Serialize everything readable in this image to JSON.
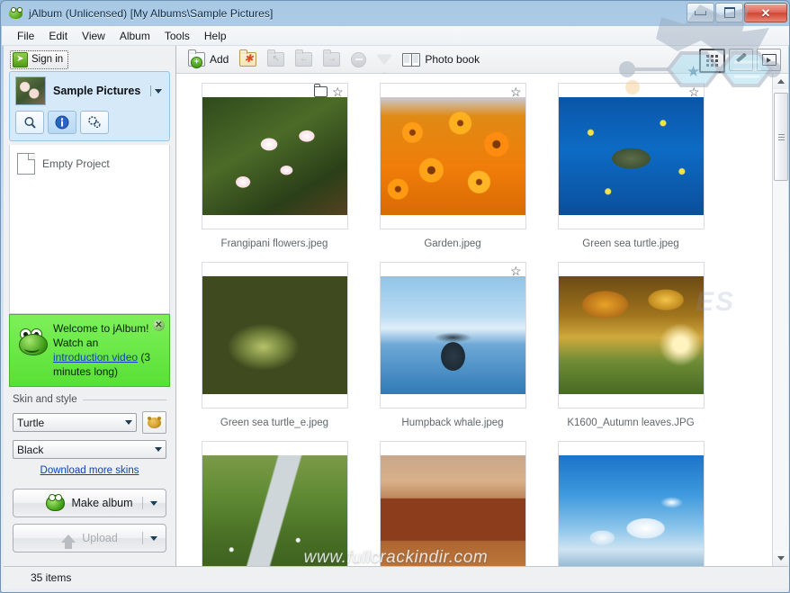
{
  "window": {
    "title": "jAlbum (Unlicensed) [My Albums\\Sample Pictures]",
    "app_icon": "frog-icon",
    "minimize_label": "–",
    "maximize_label": "",
    "close_label": "✕"
  },
  "menubar": {
    "items": [
      {
        "label": "File"
      },
      {
        "label": "Edit"
      },
      {
        "label": "View"
      },
      {
        "label": "Album"
      },
      {
        "label": "Tools"
      },
      {
        "label": "Help"
      }
    ]
  },
  "sidebar": {
    "signin": {
      "label": "Sign in",
      "icon": "arrow-right-icon"
    },
    "album": {
      "name": "Sample Pictures",
      "dropdown_icon": "chevron-down-icon",
      "tools": [
        {
          "name": "search-button",
          "icon": "magnifier-icon"
        },
        {
          "name": "info-button",
          "icon": "info-icon"
        },
        {
          "name": "settings-button",
          "icon": "gears-icon"
        }
      ]
    },
    "projects": [
      {
        "label": "Empty Project",
        "icon": "page-icon"
      }
    ],
    "welcome": {
      "line1": "Welcome to jAlbum!",
      "line2": "Watch an",
      "link": "introduction video",
      "line3": " (3 minutes long)",
      "close_label": "✕",
      "icon": "frog-icon"
    },
    "skin_section": {
      "legend": "Skin and style",
      "skin_value": "Turtle",
      "style_value": "Black",
      "skin_options": [
        "Turtle"
      ],
      "style_options": [
        "Black"
      ],
      "preview_icon": "turtle-icon",
      "download_link": "Download more skins"
    },
    "actions": [
      {
        "label": "Make album",
        "icon": "frog-icon",
        "disabled": false
      },
      {
        "label": "Upload",
        "icon": "upload-arrow-icon",
        "disabled": true
      }
    ]
  },
  "toolbar": {
    "items": [
      {
        "label": "Add",
        "icon": "folder-add-icon",
        "disabled": false
      },
      {
        "label": "",
        "icon": "folder-new-icon",
        "disabled": false
      },
      {
        "label": "",
        "icon": "folder-up-icon",
        "disabled": true
      },
      {
        "label": "",
        "icon": "folder-back-icon",
        "disabled": true
      },
      {
        "label": "",
        "icon": "folder-forward-icon",
        "disabled": true
      },
      {
        "label": "",
        "icon": "remove-icon",
        "disabled": true
      },
      {
        "label": "",
        "icon": "filter-funnel-icon",
        "disabled": true
      },
      {
        "label": "Photo book",
        "icon": "book-icon",
        "disabled": false
      }
    ],
    "view_modes": [
      {
        "name": "grid-view-button",
        "icon": "grid-icon",
        "selected": true
      },
      {
        "name": "edit-view-button",
        "icon": "pen-icon",
        "selected": false
      },
      {
        "name": "slideshow-view-button",
        "icon": "play-icon",
        "selected": false
      }
    ]
  },
  "grid": {
    "items": [
      {
        "label": "Frangipani flowers.jpeg",
        "art": "img-frangipani",
        "has_folder_icon": true,
        "has_star_icon": true
      },
      {
        "label": "Garden.jpeg",
        "art": "img-garden",
        "has_folder_icon": false,
        "has_star_icon": true
      },
      {
        "label": "Green sea turtle.jpeg",
        "art": "img-turtle-blue",
        "has_folder_icon": false,
        "has_star_icon": true
      },
      {
        "label": "Green sea turtle_e.jpeg",
        "art": "img-turtle-close",
        "has_folder_icon": false,
        "has_star_icon": false
      },
      {
        "label": "Humpback whale.jpeg",
        "art": "img-whale",
        "has_folder_icon": false,
        "has_star_icon": true
      },
      {
        "label": "K1600_Autumn leaves.JPG",
        "art": "img-autumn",
        "has_folder_icon": false,
        "has_star_icon": false
      },
      {
        "label": "",
        "art": "img-creek",
        "has_folder_icon": false,
        "has_star_icon": false
      },
      {
        "label": "",
        "art": "img-monument",
        "has_folder_icon": false,
        "has_star_icon": false
      },
      {
        "label": "",
        "art": "img-clouds",
        "has_folder_icon": false,
        "has_star_icon": false
      }
    ]
  },
  "scrollbar": {
    "up_icon": "triangle-up-icon",
    "down_icon": "triangle-down-icon"
  },
  "statusbar": {
    "text": "35 items"
  },
  "watermarks": {
    "bottom": "www.fullcrackindir.com",
    "ghost": "ES"
  },
  "colors": {
    "accent_blue": "#d6e9f8",
    "welcome_green": "#58e034",
    "link_blue": "#1040b5",
    "chrome_gray": "#eef0f1",
    "close_red": "#cf4633"
  }
}
